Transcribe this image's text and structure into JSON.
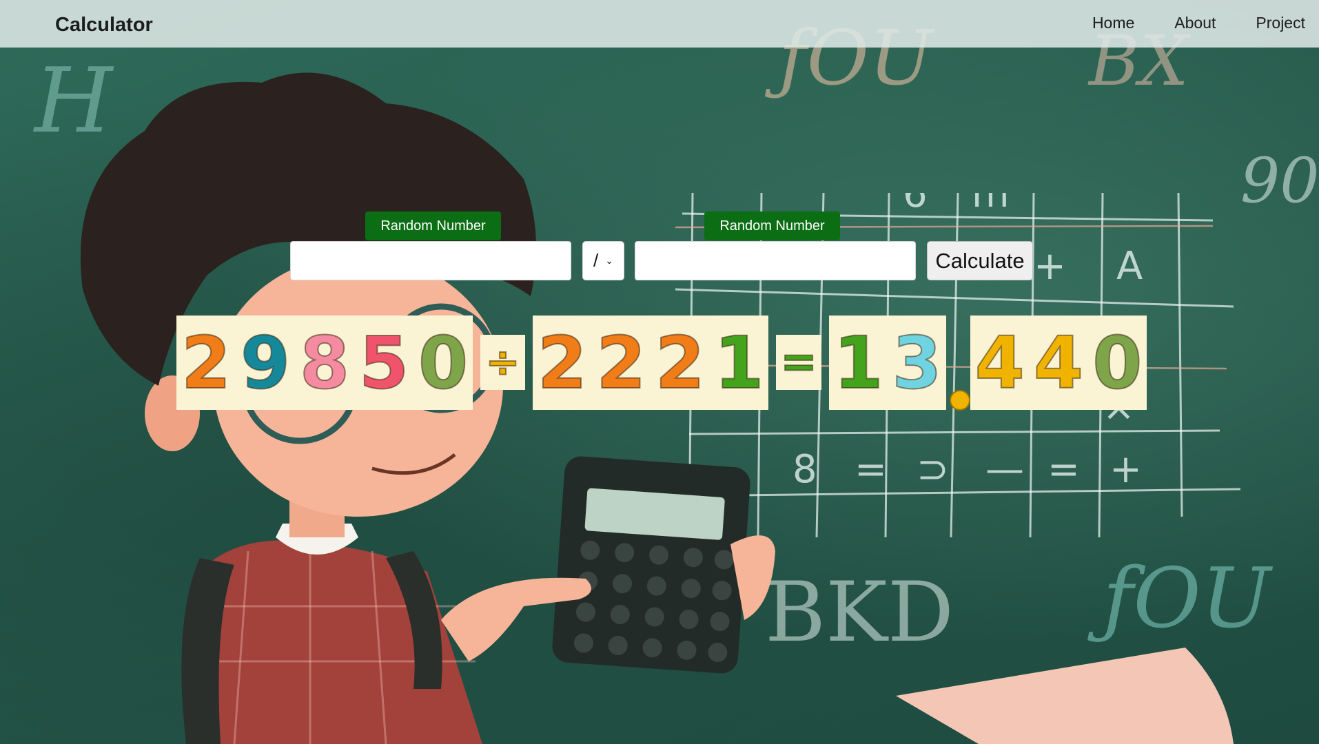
{
  "app": {
    "title": "Calculator"
  },
  "nav": {
    "items": [
      "Home",
      "About",
      "Project"
    ]
  },
  "controls": {
    "random_label_1": "Random Number",
    "random_label_2": "Random Number",
    "input_a_value": "",
    "input_b_value": "",
    "operator": "/",
    "calculate_label": "Calculate"
  },
  "equation": {
    "operand_a": [
      "2",
      "9",
      "8",
      "5",
      "0"
    ],
    "operator_symbol": "÷",
    "operand_b": [
      "2",
      "2",
      "2",
      "1"
    ],
    "equals_symbol": "=",
    "result_int": [
      "1",
      "3"
    ],
    "result_frac": [
      "4",
      "4",
      "0"
    ]
  },
  "colors": {
    "nav_bg": "#dee8e6",
    "random_button": "#0b6e14",
    "tile_bg": "#fbf4d4",
    "digit_orange": "#f07d18",
    "digit_teal": "#15899a",
    "digit_pink": "#f58ba0",
    "digit_red_pink": "#f0546c",
    "digit_olive": "#7fa54a",
    "digit_green": "#43a31c",
    "digit_light_blue": "#6fd3e0",
    "digit_yellow": "#f0b400"
  }
}
